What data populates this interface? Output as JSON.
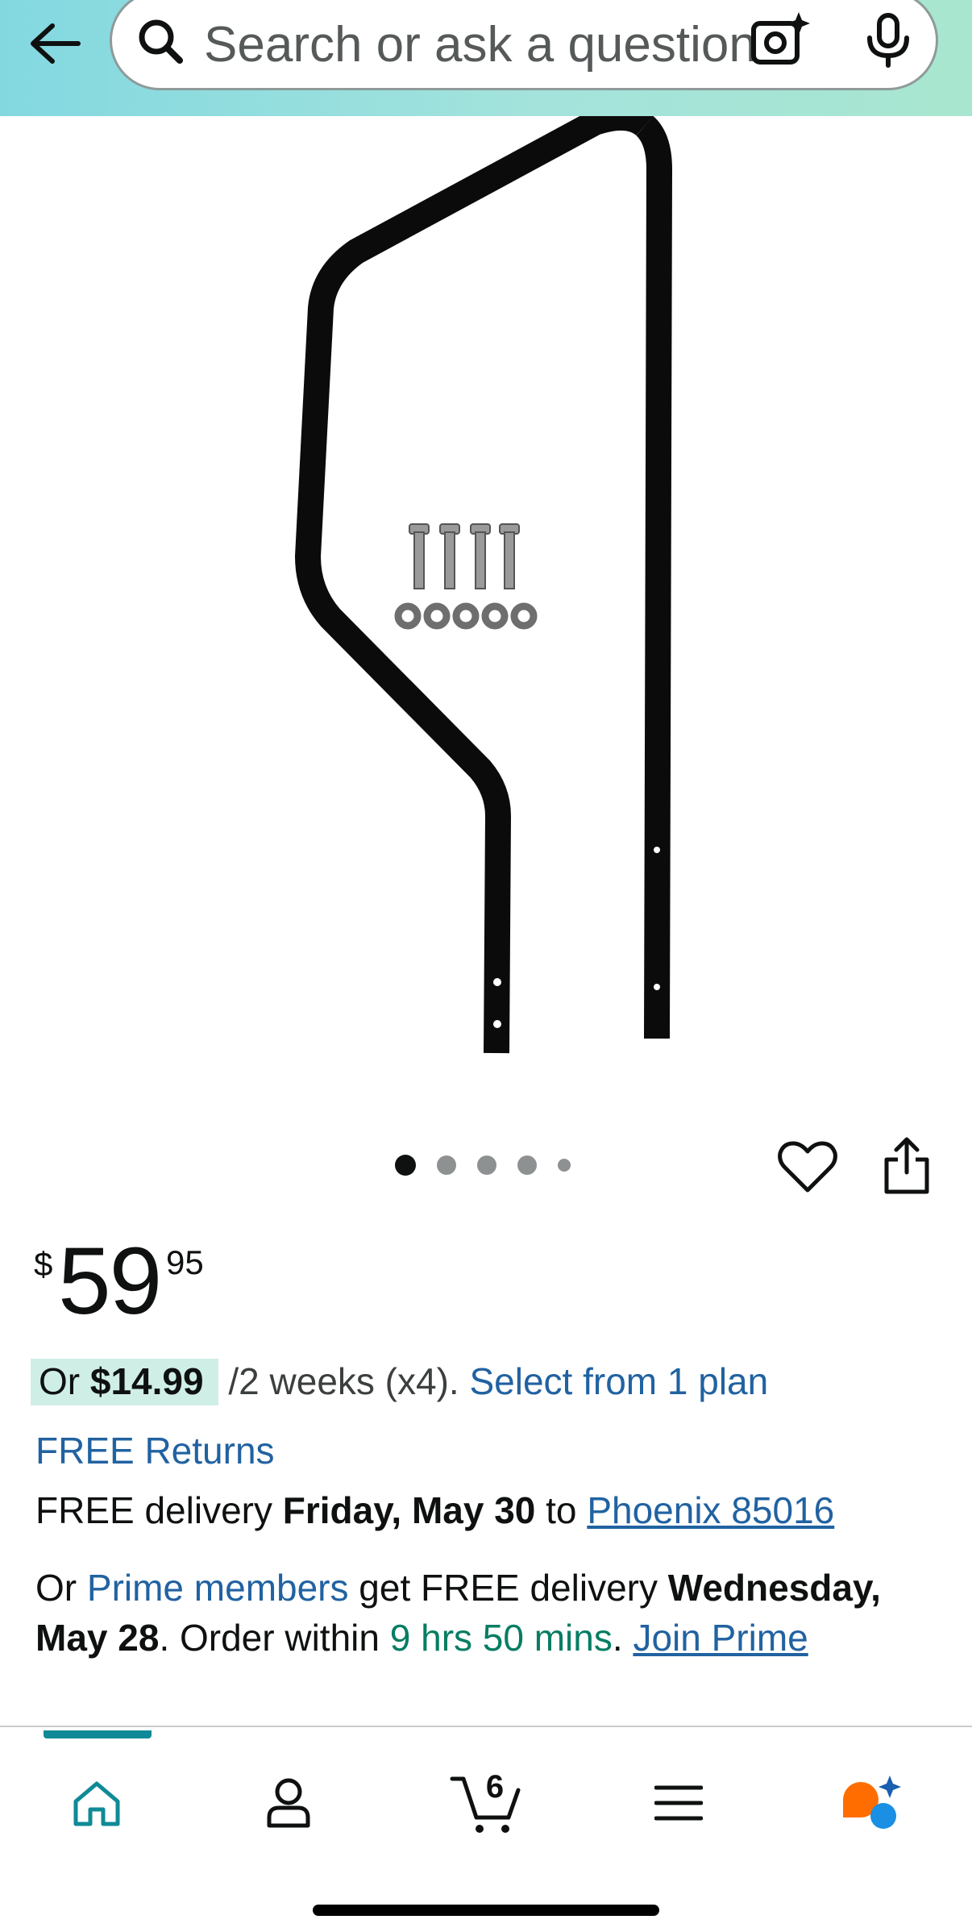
{
  "header": {
    "back_icon": "arrow-left-icon",
    "search": {
      "placeholder": "Search or ask a question",
      "search_icon": "magnifier-icon",
      "lens_icon": "camera-sparkle-icon",
      "mic_icon": "microphone-icon"
    }
  },
  "product": {
    "image_description_icon": "product-photo",
    "carousel": {
      "total_dots": 5,
      "active_index": 0
    },
    "wishlist_icon": "heart-icon",
    "share_icon": "share-icon"
  },
  "price": {
    "symbol": "$",
    "whole": "59",
    "fraction": "95"
  },
  "installments": {
    "prefix": "Or",
    "amount": "$14.99",
    "terms": "/2 weeks (x4).",
    "link": "Select from 1 plan"
  },
  "returns": {
    "label": "FREE Returns"
  },
  "delivery": {
    "prefix": "FREE delivery",
    "date": "Friday, May 30",
    "to": "to",
    "location": "Phoenix 85016"
  },
  "prime": {
    "prefix": "Or",
    "members_link": "Prime members",
    "middle": "get FREE delivery",
    "date_part1": "Wednesday,",
    "date_part2": "May 28",
    "order_within": ". Order within",
    "countdown": "9 hrs 50 mins",
    "period": ".",
    "join_link": "Join Prime"
  },
  "bottom_nav": {
    "items": [
      {
        "name": "Home",
        "icon": "home-icon",
        "active": true
      },
      {
        "name": "Account",
        "icon": "user-icon",
        "active": false
      },
      {
        "name": "Cart",
        "icon": "cart-icon",
        "count": "6",
        "active": false
      },
      {
        "name": "Menu",
        "icon": "hamburger-menu-icon",
        "active": false
      },
      {
        "name": "Rufus",
        "icon": "ai-assistant-icon",
        "active": false
      }
    ]
  },
  "colors": {
    "header_gradient_start": "#83d8e0",
    "header_gradient_end": "#a8e6cf",
    "link": "#2162a1",
    "teal_accent": "#0f8a96",
    "countdown_green": "#067d62",
    "installment_highlight": "#cfeee6"
  }
}
